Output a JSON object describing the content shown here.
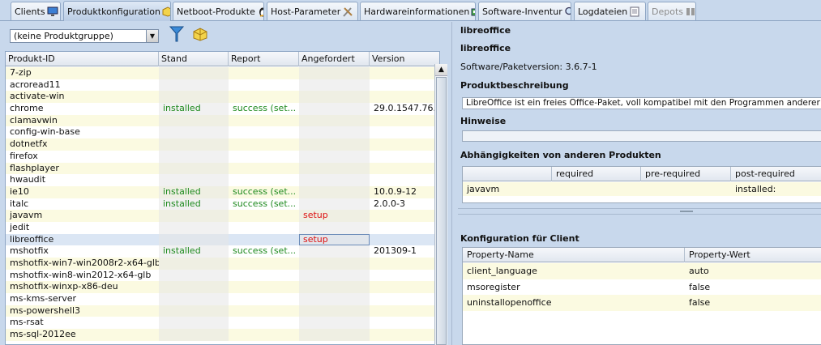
{
  "tabs": [
    {
      "label": "Clients",
      "icon": "monitor-icon"
    },
    {
      "label": "Produktkonfiguration",
      "icon": "package-icon"
    },
    {
      "label": "Netboot-Produkte",
      "icon": "penguin-icon"
    },
    {
      "label": "Host-Parameter",
      "icon": "tools-icon"
    },
    {
      "label": "Hardwareinformationen",
      "icon": "hardware-icon"
    },
    {
      "label": "Software-Inventur",
      "icon": "magnifier-icon"
    },
    {
      "label": "Logdateien",
      "icon": "document-icon"
    },
    {
      "label": "Depots",
      "icon": "depot-icon"
    }
  ],
  "left": {
    "product_group": "(keine Produktgruppe)",
    "columns": [
      "Produkt-ID",
      "Stand",
      "Report",
      "Angefordert",
      "Version"
    ],
    "rows": [
      {
        "id": "7-zip",
        "stand": "",
        "report": "",
        "req": "",
        "ver": ""
      },
      {
        "id": "acroread11",
        "stand": "",
        "report": "",
        "req": "",
        "ver": ""
      },
      {
        "id": "activate-win",
        "stand": "",
        "report": "",
        "req": "",
        "ver": ""
      },
      {
        "id": "chrome",
        "stand": "installed",
        "report": "success (set...",
        "req": "",
        "ver": "29.0.1547.76..."
      },
      {
        "id": "clamavwin",
        "stand": "",
        "report": "",
        "req": "",
        "ver": ""
      },
      {
        "id": "config-win-base",
        "stand": "",
        "report": "",
        "req": "",
        "ver": ""
      },
      {
        "id": "dotnetfx",
        "stand": "",
        "report": "",
        "req": "",
        "ver": ""
      },
      {
        "id": "firefox",
        "stand": "",
        "report": "",
        "req": "",
        "ver": ""
      },
      {
        "id": "flashplayer",
        "stand": "",
        "report": "",
        "req": "",
        "ver": ""
      },
      {
        "id": "hwaudit",
        "stand": "",
        "report": "",
        "req": "",
        "ver": ""
      },
      {
        "id": "ie10",
        "stand": "installed",
        "report": "success (set...",
        "req": "",
        "ver": "10.0.9-12"
      },
      {
        "id": "italc",
        "stand": "installed",
        "report": "success (set...",
        "req": "",
        "ver": "2.0.0-3"
      },
      {
        "id": "javavm",
        "stand": "",
        "report": "",
        "req": "setup",
        "ver": ""
      },
      {
        "id": "jedit",
        "stand": "",
        "report": "",
        "req": "",
        "ver": ""
      },
      {
        "id": "libreoffice",
        "stand": "",
        "report": "",
        "req": "setup",
        "ver": ""
      },
      {
        "id": "mshotfix",
        "stand": "installed",
        "report": "success (set...",
        "req": "",
        "ver": "201309-1"
      },
      {
        "id": "mshotfix-win7-win2008r2-x64-glb",
        "stand": "",
        "report": "",
        "req": "",
        "ver": ""
      },
      {
        "id": "mshotfix-win8-win2012-x64-glb",
        "stand": "",
        "report": "",
        "req": "",
        "ver": ""
      },
      {
        "id": "mshotfix-winxp-x86-deu",
        "stand": "",
        "report": "",
        "req": "",
        "ver": ""
      },
      {
        "id": "ms-kms-server",
        "stand": "",
        "report": "",
        "req": "",
        "ver": ""
      },
      {
        "id": "ms-powershell3",
        "stand": "",
        "report": "",
        "req": "",
        "ver": ""
      },
      {
        "id": "ms-rsat",
        "stand": "",
        "report": "",
        "req": "",
        "ver": ""
      },
      {
        "id": "ms-sql-2012ee",
        "stand": "",
        "report": "",
        "req": "",
        "ver": ""
      }
    ]
  },
  "right": {
    "title1": "libreoffice",
    "title2": "libreoffice",
    "version_label": "Software/Paketversion:",
    "version_value": "3.6.7-1",
    "desc_heading": "Produktbeschreibung",
    "desc_text": "LibreOffice ist ein freies Office-Paket, voll kompatibel mit den Programmen anderer grosser Office-",
    "hints_heading": "Hinweise",
    "deps_heading": "Abhängigkeiten von anderen Produkten",
    "deps_columns": [
      "",
      "required",
      "pre-required",
      "post-required"
    ],
    "deps_rows": [
      {
        "product": "javavm",
        "required": "",
        "pre": "",
        "post": "installed:"
      }
    ],
    "config_heading": "Konfiguration für Client",
    "prop_columns": [
      "Property-Name",
      "Property-Wert"
    ],
    "props": [
      {
        "name": "client_language",
        "value": "auto"
      },
      {
        "name": "msoregister",
        "value": "false"
      },
      {
        "name": "uninstallopenoffice",
        "value": "false"
      }
    ]
  }
}
